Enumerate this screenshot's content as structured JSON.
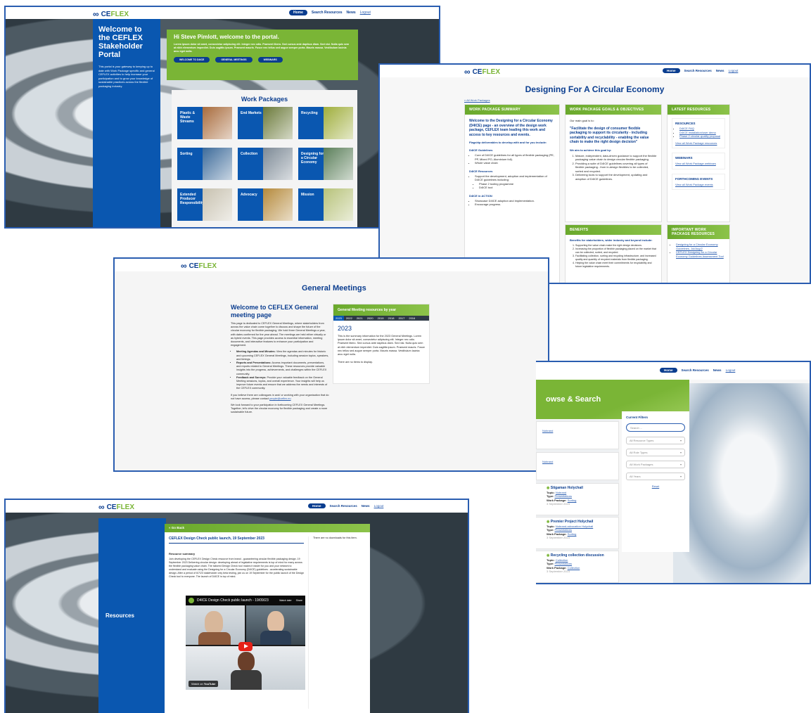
{
  "brand": {
    "logo_text_a": "CE",
    "logo_text_b": "FLEX",
    "logo_mark": "∞"
  },
  "nav": {
    "home": "Home",
    "search_resources": "Search Resources",
    "news": "News",
    "logout": "Logout"
  },
  "portal": {
    "side_title": "Welcome to the CEFLEX Stakeholder Portal",
    "side_text": "This portal is your gateway to keeping up to date with Work Package specific and general CEFLEX activities to help increase your participation and to grow your knowledge of sustainable practices across the flexible packaging industry.",
    "welcome_title": "Hi Steve Pimlott, welcome to the portal.",
    "welcome_text": "Lorem ipsum dolor sit amet, consectetur adipiscing elit. Integer nec odio. Praesent libero. Sed cursus ante dapibus diam. Sed nisi. Nulla quis sem at nibh elementum imperdiet. Duis sagittis ipsum. Praesent mauris. Fusce nec tellus sed augue semper porta. Mauris massa. Vestibulum lacinia arcu eget nulla.",
    "buttons": [
      "WELCOME TO D4ICE",
      "GENERAL MEETINGS",
      "WEBINARS"
    ],
    "work_packages_title": "Work Packages",
    "packages": [
      {
        "label": "Plastic & Waste Streams",
        "color": "#a86b3c"
      },
      {
        "label": "End Markets",
        "color": "#6b7a3a"
      },
      {
        "label": "Recycling",
        "color": "#9fae3c"
      },
      {
        "label": "Sorting",
        "color": "#3d6b9a"
      },
      {
        "label": "Collection",
        "color": "#7d8a96"
      },
      {
        "label": "Designing for a Circular Economy",
        "color": "#5b7f5a"
      },
      {
        "label": "Extended Producer Responsibility",
        "color": "#c8c2b0"
      },
      {
        "label": "Advocacy",
        "color": "#b58a3c"
      },
      {
        "label": "Mission",
        "color": "#b7c27a"
      }
    ]
  },
  "design": {
    "title": "Designing For A Circular Economy",
    "breadcrumb": "« All Work Packages",
    "summary_head": "WORK PACKAGE SUMMARY",
    "summary_title": "Welcome to the Designing for a Circular Economy (D4ICE) page - an overview of the design work package, CEFLEX team leading this work and access to key resources and events.",
    "flagship": "Flagship deliverables to develop with and for you include:",
    "d4ice_guidelines": "D4ICE Guidelines",
    "g_items": [
      "Core of D4ICE guidelines for all types of flexible packaging (PE, PP, Mixed PO, Aluminium foil).",
      "Whole value chain"
    ],
    "d4ice_resources": "D4ICE Resources",
    "r_items": [
      "Support the development, adoption and implementation of D4ICE guidelines including:",
      "Phase 2 tooling programme",
      "D4ICE tool"
    ],
    "d4ice_action": "D4ICE in ACTION",
    "a_items": [
      "Showcase D4ICE adoption and implementation.",
      "Encourage progress."
    ],
    "goals_head": "WORK PACKAGE GOALS & OBJECTIVES",
    "goals_intro": "Our main goal is to:",
    "goals_quote": "\"Facilitate the design of consumer flexible packaging to support its circularity - including sortability and recyclability - enabling the value chain to make the right design decision\"",
    "goals_aim": "We aim to achieve this goal by:",
    "goal_items": [
      "Mature, independent, data-driven guidance to support the flexible packaging value chain to design circular flexible packaging.",
      "Providing a suite of D4ICE guidelines covering all types of flexible packaging - from in-design flexibles to be collected, sorted and recycled.",
      "Delivering tools to support the development, updating and adoption of D4ICE guidelines."
    ],
    "benefits_head": "BENEFITS",
    "benefits_intro": "Benefits for stakeholders, wider industry and beyond include:",
    "benefit_items": [
      "Supporting the value chain make the right design decisions.",
      "Increasing the proportion of flexible packaging placed on the market that can be collected, sorted, and recycled.",
      "Facilitating collection, sorting and recycling infrastructure, and increased quality and quantity of recycled materials from flexible packaging.",
      "Helping the value chain meet their commitments for recyclability and future legislative requirements."
    ],
    "latest_head": "LATEST RESOURCES",
    "resources_title": "RESOURCES",
    "resource_links": [
      "D4ICE FAQ",
      "D4ICE installation/user demo",
      "Phase 2 circular-quality proposal"
    ],
    "view_all_resources": "View all Work Package resources",
    "webinars_title": "WEBINARS",
    "view_all_webinars": "View all Work Package webinars",
    "events_title": "FORTHCOMING EVENTS",
    "view_all_events": "View all Work Package events",
    "important_head": "IMPORTANT WORK PACKAGE RESOURCES",
    "important_links": [
      "Designing for a Circular Economy Guidelines, Jul/Aug/2",
      "CEFLEX Designing for a Circular Economy Guidelines Assessment Tool"
    ]
  },
  "meetings": {
    "title": "General Meetings",
    "welcome_title": "Welcome to CEFLEX General meeting page",
    "intro": "This page is dedicated to CEFLEX General Meetings, where stakeholders from across the value chain come together to discuss and shape the future of the circular economy for flexible packaging. We hold three General Meetings a year, with dates confirmed for the year ahead. The meetings are held either virtually or as hybrid events. This page provides access to essential information, meeting documents, and interactive features to enhance your participation and engagement.",
    "bullets": [
      {
        "b": "Meeting Agendas and Minutes:",
        "t": "View the agendas and minutes for historic and upcoming CEFLEX General Meetings, including session topics, speakers, and timings."
      },
      {
        "b": "Reports and Presentations:",
        "t": "Access important documents, presentations, and reports related to General Meetings. These resources provide valuable insights into the progress, achievements, and challenges within the CEFLEX community."
      },
      {
        "b": "Feedback and Surveys:",
        "t": "Provide your valuable feedback on the General Meeting sessions, topics, and overall experience. Your insights will help us improve future events and ensure that we address the needs and interests of the CEFLEX community."
      }
    ],
    "colleagues": "If you believe there are colleagues in and/ or working with your organisation that do not have access, please contact",
    "contact_link": "people@ceflex.eu",
    "closing": "We look forward to your participation in forthcoming CEFLEX General Meetings. Together, let's drive the circular economy for flexible packaging and create a more sustainable future.",
    "year_panel_head": "General Meeting resources by year",
    "years": [
      "2023",
      "2022",
      "2021",
      "2020",
      "2019",
      "2018",
      "2017",
      "2016"
    ],
    "selected_year": "2023",
    "year_text": "This is the summary information for the 2023 General Meetings. Lorem ipsum dolor sit amet, consectetur adipiscing elit. Integer nec odio. Praesent libero. Sed cursus ante dapibus diam. Sed nisi. Nulla quis sem at nibh elementum imperdiet. Duis sagittis ipsum. Praesent mauris. Fusce nec tellus sed augue semper porta. Mauris massa. Vestibulum lacinia arcu eget nulla.",
    "no_items": "There are no items to display."
  },
  "browse": {
    "title": "owse & Search",
    "filters_title": "Current Filters",
    "search_placeholder": "Search ...",
    "filters": [
      "All Resource Types",
      "All Role Types",
      "All Work Packages",
      "All Years"
    ],
    "reset": "Reset",
    "cards": [
      {
        "title": "",
        "link": "Nobrand"
      },
      {
        "title": "",
        "link": "Nobrand"
      },
      {
        "title": "Stigaman Holychail",
        "topic": "Nobrand",
        "type": "Presentations",
        "wp": "Sorting",
        "date": "3 September 2023"
      },
      {
        "title": "Premier Project Holychail",
        "topic": "Nobrand-advocation Holychail",
        "type": "Presentations",
        "wp": "Sorting",
        "date": "3 September 2023"
      },
      {
        "title": "Recycling collection discussion",
        "topic": "Collection",
        "type": "Presentations",
        "wp": "Collection",
        "date": "3 September 2023"
      }
    ],
    "label_topic": "Topic:",
    "label_type": "Type:",
    "label_wp": "Work Package:"
  },
  "resources": {
    "side_title": "Resources",
    "back": "« Go Back",
    "article_title": "CEFLEX Design Check public launch, 19 September 2023",
    "summary_label": "Resource summary",
    "summary_text": "Join developing the CEFLEX Design Check resource from brand - guaranteeing circular flexible packaging design. 19 September 2023 Delivering circular design: developing ahead of legislative requirements is top of mind for many across the flexible packaging value chain. The tailored Design Check tool makes it easier for you and your network to understand and evaluate using the Designing for a Circular Economy (D4ICE) guidelines - accelerating sustainable design. After a period of 6/7/23 stakeholder only beta testing, join us on 19 September for the public launch of the Design Check tool to everyone. The launch of D4ICE is top of mind.",
    "no_downloads": "There are no downloads for this item.",
    "video_title": "D4ICE Design Check public launch - 19/09/23",
    "watch_later": "Watch later",
    "share": "Share",
    "watch_on": "Watch on",
    "youtube": "YouTube"
  },
  "colors": {
    "brand_blue": "#0a3d8f",
    "side_blue": "#0a57b0",
    "brand_green": "#7ab536",
    "frame_blue": "#2a5db0"
  }
}
